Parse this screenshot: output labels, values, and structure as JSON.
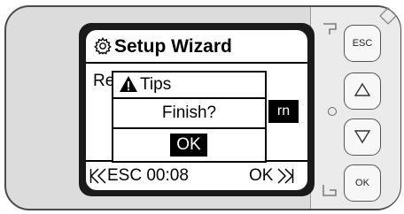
{
  "screen": {
    "title": "Setup Wizard",
    "background_text": "Re",
    "background_button_label": "rn",
    "bottom_bar": {
      "esc_timer": "ESC 00:08",
      "ok_label": "OK"
    }
  },
  "dialog": {
    "title": "Tips",
    "message": "Finish?",
    "ok_label": "OK"
  },
  "keys": {
    "esc_label": "ESC",
    "ok_label": "OK"
  },
  "icons": [
    "gear-icon",
    "warning-icon",
    "prev-page-icon",
    "next-page-icon",
    "up-triangle-icon",
    "down-triangle-icon"
  ]
}
